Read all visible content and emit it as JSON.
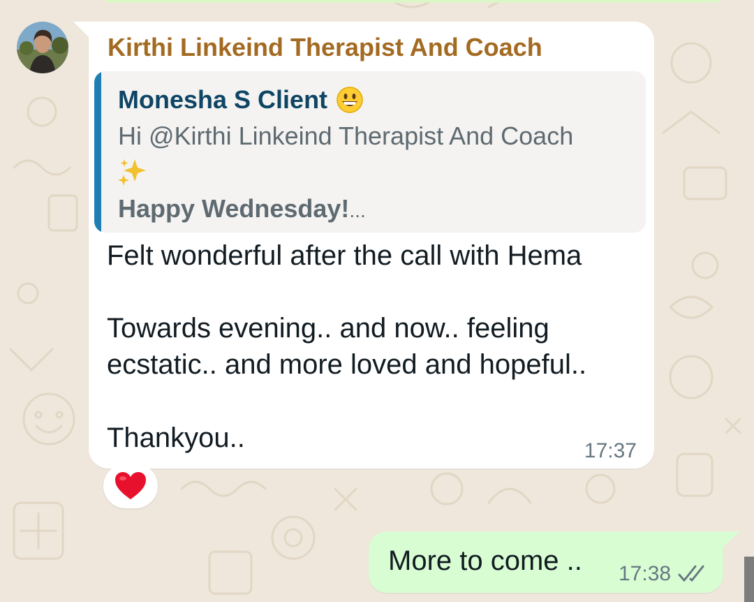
{
  "chat": {
    "incoming": {
      "sender_name": "Kirthi Linkeind Therapist And Coach",
      "quoted": {
        "author": "Monesha S Client",
        "author_emoji_icon": "grinning-face-emoji",
        "line1": "Hi @Kirthi Linkeind Therapist And Coach",
        "sparkles_icon": "sparkles-emoji",
        "bold_line": "Happy Wednesday!",
        "truncation": "..."
      },
      "lines": [
        "Felt wonderful after the call with Hema",
        "Towards evening.. and now.. feeling",
        "ecstatic.. and more loved and hopeful..",
        "Thankyou.."
      ],
      "time": "17:37",
      "reaction_icon": "red-heart-emoji"
    },
    "outgoing": {
      "text": "More to come ..",
      "time": "17:38",
      "status_icon": "double-check-icon"
    }
  },
  "colors": {
    "wallpaper": "#efe7dc",
    "sender_name": "#a36a21",
    "quote_bar": "#1f7fb5",
    "outgoing_bubble": "#d9fdd3",
    "read_ticks": "#667781"
  }
}
